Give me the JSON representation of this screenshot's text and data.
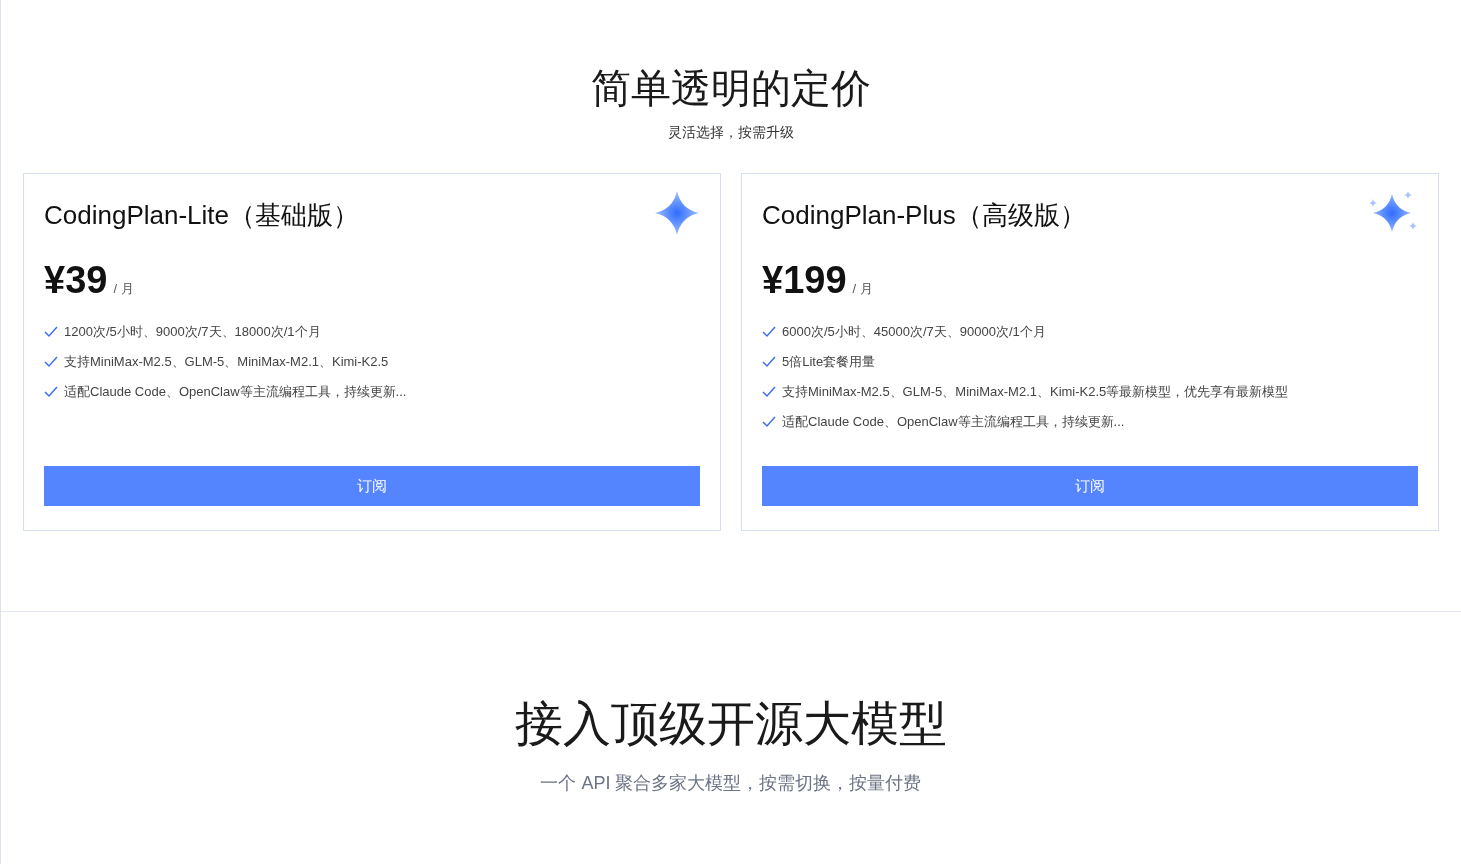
{
  "pricing": {
    "title": "简单透明的定价",
    "subtitle": "灵活选择，按需升级",
    "plans": [
      {
        "kind": "single",
        "name": "CodingPlan-Lite（基础版）",
        "price": "¥39",
        "period": "/ 月",
        "features": [
          "1200次/5小时、9000次/7天、18000次/1个月",
          "支持MiniMax-M2.5、GLM-5、MiniMax-M2.1、Kimi-K2.5",
          "适配Claude Code、OpenClaw等主流编程工具，持续更新..."
        ],
        "button": "订阅"
      },
      {
        "kind": "cluster",
        "name": "CodingPlan-Plus（高级版）",
        "price": "¥199",
        "period": "/ 月",
        "features": [
          "6000次/5小时、45000次/7天、90000次/1个月",
          "5倍Lite套餐用量",
          "支持MiniMax-M2.5、GLM-5、MiniMax-M2.1、Kimi-K2.5等最新模型，优先享有最新模型",
          "适配Claude Code、OpenClaw等主流编程工具，持续更新..."
        ],
        "button": "订阅"
      }
    ]
  },
  "models": {
    "title": "接入顶级开源大模型",
    "subtitle": "一个 API 聚合多家大模型，按需切换，按量付费"
  }
}
